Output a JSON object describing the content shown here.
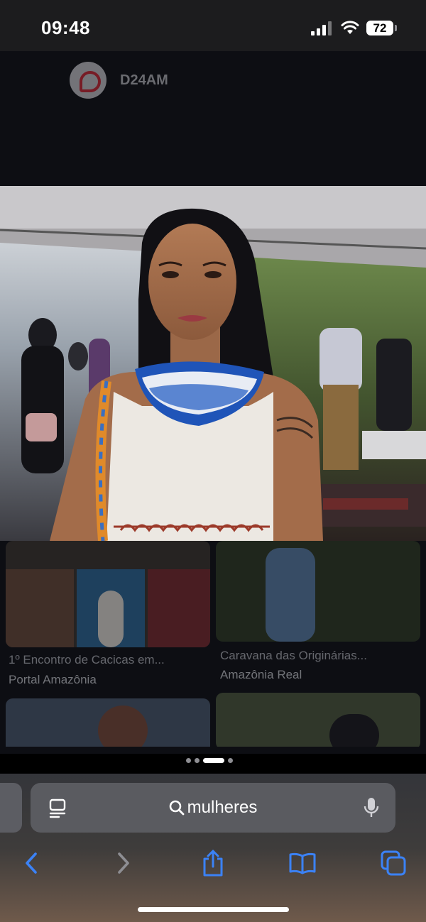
{
  "status_bar": {
    "time": "09:48",
    "battery": "72"
  },
  "page": {
    "source_name": "D24AM"
  },
  "results": [
    {
      "title": "1º Encontro de Cacicas em...",
      "source": "Portal Amazônia"
    },
    {
      "title": "Caravana das Originárias...",
      "source": "Amazônia Real"
    }
  ],
  "pager": {
    "page_count": 4,
    "active_index": 2
  },
  "toolbar": {
    "search_query": "mulheres",
    "icons": [
      "reader-icon",
      "search-icon",
      "microphone-icon",
      "back-icon",
      "forward-icon",
      "share-icon",
      "bookmarks-icon",
      "tabs-icon"
    ]
  },
  "colors": {
    "accent": "#3b82f6",
    "logo_red": "#e02b3a"
  }
}
